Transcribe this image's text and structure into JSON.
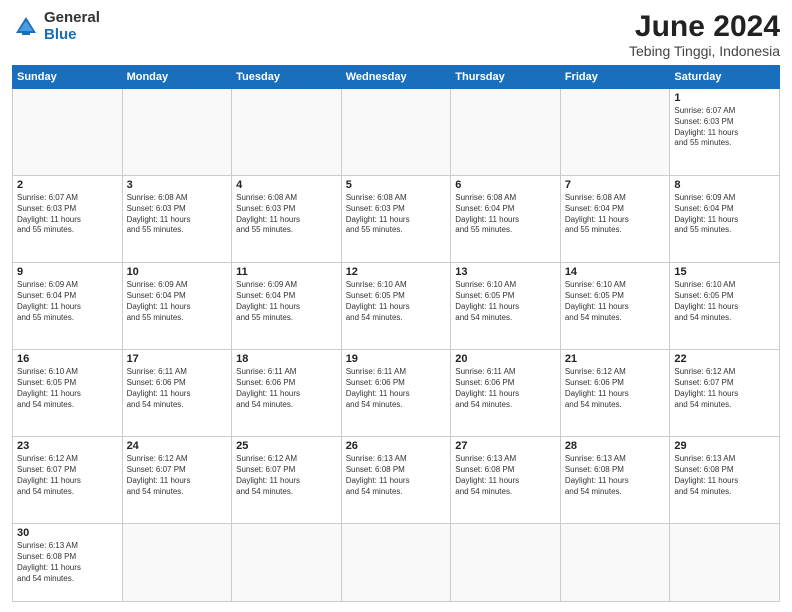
{
  "header": {
    "logo_general": "General",
    "logo_blue": "Blue",
    "title": "June 2024",
    "location": "Tebing Tinggi, Indonesia"
  },
  "weekdays": [
    "Sunday",
    "Monday",
    "Tuesday",
    "Wednesday",
    "Thursday",
    "Friday",
    "Saturday"
  ],
  "weeks": [
    [
      {
        "day": "",
        "info": ""
      },
      {
        "day": "",
        "info": ""
      },
      {
        "day": "",
        "info": ""
      },
      {
        "day": "",
        "info": ""
      },
      {
        "day": "",
        "info": ""
      },
      {
        "day": "",
        "info": ""
      },
      {
        "day": "1",
        "info": "Sunrise: 6:07 AM\nSunset: 6:03 PM\nDaylight: 11 hours\nand 55 minutes."
      }
    ],
    [
      {
        "day": "2",
        "info": "Sunrise: 6:07 AM\nSunset: 6:03 PM\nDaylight: 11 hours\nand 55 minutes."
      },
      {
        "day": "3",
        "info": "Sunrise: 6:08 AM\nSunset: 6:03 PM\nDaylight: 11 hours\nand 55 minutes."
      },
      {
        "day": "4",
        "info": "Sunrise: 6:08 AM\nSunset: 6:03 PM\nDaylight: 11 hours\nand 55 minutes."
      },
      {
        "day": "5",
        "info": "Sunrise: 6:08 AM\nSunset: 6:03 PM\nDaylight: 11 hours\nand 55 minutes."
      },
      {
        "day": "6",
        "info": "Sunrise: 6:08 AM\nSunset: 6:04 PM\nDaylight: 11 hours\nand 55 minutes."
      },
      {
        "day": "7",
        "info": "Sunrise: 6:08 AM\nSunset: 6:04 PM\nDaylight: 11 hours\nand 55 minutes."
      },
      {
        "day": "8",
        "info": "Sunrise: 6:09 AM\nSunset: 6:04 PM\nDaylight: 11 hours\nand 55 minutes."
      }
    ],
    [
      {
        "day": "9",
        "info": "Sunrise: 6:09 AM\nSunset: 6:04 PM\nDaylight: 11 hours\nand 55 minutes."
      },
      {
        "day": "10",
        "info": "Sunrise: 6:09 AM\nSunset: 6:04 PM\nDaylight: 11 hours\nand 55 minutes."
      },
      {
        "day": "11",
        "info": "Sunrise: 6:09 AM\nSunset: 6:04 PM\nDaylight: 11 hours\nand 55 minutes."
      },
      {
        "day": "12",
        "info": "Sunrise: 6:10 AM\nSunset: 6:05 PM\nDaylight: 11 hours\nand 54 minutes."
      },
      {
        "day": "13",
        "info": "Sunrise: 6:10 AM\nSunset: 6:05 PM\nDaylight: 11 hours\nand 54 minutes."
      },
      {
        "day": "14",
        "info": "Sunrise: 6:10 AM\nSunset: 6:05 PM\nDaylight: 11 hours\nand 54 minutes."
      },
      {
        "day": "15",
        "info": "Sunrise: 6:10 AM\nSunset: 6:05 PM\nDaylight: 11 hours\nand 54 minutes."
      }
    ],
    [
      {
        "day": "16",
        "info": "Sunrise: 6:10 AM\nSunset: 6:05 PM\nDaylight: 11 hours\nand 54 minutes."
      },
      {
        "day": "17",
        "info": "Sunrise: 6:11 AM\nSunset: 6:06 PM\nDaylight: 11 hours\nand 54 minutes."
      },
      {
        "day": "18",
        "info": "Sunrise: 6:11 AM\nSunset: 6:06 PM\nDaylight: 11 hours\nand 54 minutes."
      },
      {
        "day": "19",
        "info": "Sunrise: 6:11 AM\nSunset: 6:06 PM\nDaylight: 11 hours\nand 54 minutes."
      },
      {
        "day": "20",
        "info": "Sunrise: 6:11 AM\nSunset: 6:06 PM\nDaylight: 11 hours\nand 54 minutes."
      },
      {
        "day": "21",
        "info": "Sunrise: 6:12 AM\nSunset: 6:06 PM\nDaylight: 11 hours\nand 54 minutes."
      },
      {
        "day": "22",
        "info": "Sunrise: 6:12 AM\nSunset: 6:07 PM\nDaylight: 11 hours\nand 54 minutes."
      }
    ],
    [
      {
        "day": "23",
        "info": "Sunrise: 6:12 AM\nSunset: 6:07 PM\nDaylight: 11 hours\nand 54 minutes."
      },
      {
        "day": "24",
        "info": "Sunrise: 6:12 AM\nSunset: 6:07 PM\nDaylight: 11 hours\nand 54 minutes."
      },
      {
        "day": "25",
        "info": "Sunrise: 6:12 AM\nSunset: 6:07 PM\nDaylight: 11 hours\nand 54 minutes."
      },
      {
        "day": "26",
        "info": "Sunrise: 6:13 AM\nSunset: 6:08 PM\nDaylight: 11 hours\nand 54 minutes."
      },
      {
        "day": "27",
        "info": "Sunrise: 6:13 AM\nSunset: 6:08 PM\nDaylight: 11 hours\nand 54 minutes."
      },
      {
        "day": "28",
        "info": "Sunrise: 6:13 AM\nSunset: 6:08 PM\nDaylight: 11 hours\nand 54 minutes."
      },
      {
        "day": "29",
        "info": "Sunrise: 6:13 AM\nSunset: 6:08 PM\nDaylight: 11 hours\nand 54 minutes."
      }
    ],
    [
      {
        "day": "30",
        "info": "Sunrise: 6:13 AM\nSunset: 6:08 PM\nDaylight: 11 hours\nand 54 minutes."
      },
      {
        "day": "",
        "info": ""
      },
      {
        "day": "",
        "info": ""
      },
      {
        "day": "",
        "info": ""
      },
      {
        "day": "",
        "info": ""
      },
      {
        "day": "",
        "info": ""
      },
      {
        "day": "",
        "info": ""
      }
    ]
  ]
}
